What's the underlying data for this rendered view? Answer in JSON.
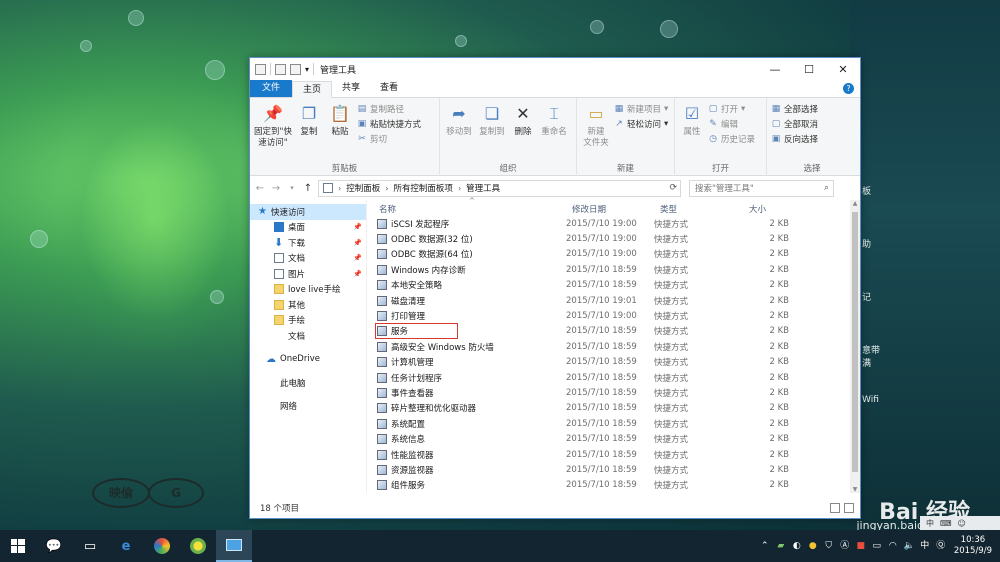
{
  "window": {
    "title": "管理工具",
    "controls": {
      "minimize": "—",
      "maximize": "☐",
      "close": "✕"
    }
  },
  "tabs": {
    "file": "文件",
    "home": "主页",
    "share": "共享",
    "view": "查看"
  },
  "ribbon": {
    "clipboard": {
      "label": "剪贴板",
      "pin": "固定到\"快\n速访问\"",
      "copy": "复制",
      "paste": "粘贴",
      "copy_path": "复制路径",
      "paste_shortcut": "粘贴快捷方式",
      "cut": "剪切"
    },
    "organize": {
      "label": "组织",
      "move_to": "移动到",
      "copy_to": "复制到",
      "delete": "删除",
      "rename": "重命名"
    },
    "new": {
      "label": "新建",
      "new_folder": "新建\n文件夹",
      "new_item": "新建项目",
      "easy_access": "轻松访问"
    },
    "open": {
      "label": "打开",
      "properties": "属性",
      "open": "打开",
      "edit": "编辑",
      "history": "历史记录"
    },
    "select": {
      "label": "选择",
      "select_all": "全部选择",
      "select_none": "全部取消",
      "invert": "反向选择"
    }
  },
  "address": {
    "crumbs": [
      "控制面板",
      "所有控制面板项",
      "管理工具"
    ],
    "search_placeholder": "搜索\"管理工具\""
  },
  "nav": {
    "quick_access": "快速访问",
    "quick_items": [
      "桌面",
      "下载",
      "文档",
      "图片",
      "love live手绘",
      "其他",
      "手绘",
      "文档"
    ],
    "onedrive": "OneDrive",
    "this_pc": "此电脑",
    "network": "网络"
  },
  "columns": {
    "name": "名称",
    "modified": "修改日期",
    "type": "类型",
    "size": "大小"
  },
  "files": [
    {
      "name": "iSCSI 发起程序",
      "date": "2015/7/10 19:00",
      "type": "快捷方式",
      "size": "2 KB"
    },
    {
      "name": "ODBC 数据源(32 位)",
      "date": "2015/7/10 19:00",
      "type": "快捷方式",
      "size": "2 KB"
    },
    {
      "name": "ODBC 数据源(64 位)",
      "date": "2015/7/10 19:00",
      "type": "快捷方式",
      "size": "2 KB"
    },
    {
      "name": "Windows 内存诊断",
      "date": "2015/7/10 18:59",
      "type": "快捷方式",
      "size": "2 KB"
    },
    {
      "name": "本地安全策略",
      "date": "2015/7/10 18:59",
      "type": "快捷方式",
      "size": "2 KB"
    },
    {
      "name": "磁盘清理",
      "date": "2015/7/10 19:01",
      "type": "快捷方式",
      "size": "2 KB"
    },
    {
      "name": "打印管理",
      "date": "2015/7/10 19:00",
      "type": "快捷方式",
      "size": "2 KB"
    },
    {
      "name": "服务",
      "date": "2015/7/10 18:59",
      "type": "快捷方式",
      "size": "2 KB"
    },
    {
      "name": "高级安全 Windows 防火墙",
      "date": "2015/7/10 18:59",
      "type": "快捷方式",
      "size": "2 KB"
    },
    {
      "name": "计算机管理",
      "date": "2015/7/10 18:59",
      "type": "快捷方式",
      "size": "2 KB"
    },
    {
      "name": "任务计划程序",
      "date": "2015/7/10 18:59",
      "type": "快捷方式",
      "size": "2 KB"
    },
    {
      "name": "事件查看器",
      "date": "2015/7/10 18:59",
      "type": "快捷方式",
      "size": "2 KB"
    },
    {
      "name": "碎片整理和优化驱动器",
      "date": "2015/7/10 18:59",
      "type": "快捷方式",
      "size": "2 KB"
    },
    {
      "name": "系统配置",
      "date": "2015/7/10 18:59",
      "type": "快捷方式",
      "size": "2 KB"
    },
    {
      "name": "系统信息",
      "date": "2015/7/10 18:59",
      "type": "快捷方式",
      "size": "2 KB"
    },
    {
      "name": "性能监视器",
      "date": "2015/7/10 18:59",
      "type": "快捷方式",
      "size": "2 KB"
    },
    {
      "name": "资源监视器",
      "date": "2015/7/10 18:59",
      "type": "快捷方式",
      "size": "2 KB"
    },
    {
      "name": "组件服务",
      "date": "2015/7/10 18:59",
      "type": "快捷方式",
      "size": "2 KB"
    }
  ],
  "status": {
    "count": "18 个项目"
  },
  "desktop": {
    "side_labels": [
      "板",
      "助",
      "记",
      "意带\n满",
      "Wifi"
    ],
    "logo_left": "映倫",
    "logo_left_sub": "EIRIN",
    "logo_right": "G",
    "watermark": "Bai 经验",
    "watermark_url": "jingyan.baidu.com"
  },
  "taskbar": {
    "time": "10:36",
    "date": "2015/9/9",
    "ime": "中"
  }
}
